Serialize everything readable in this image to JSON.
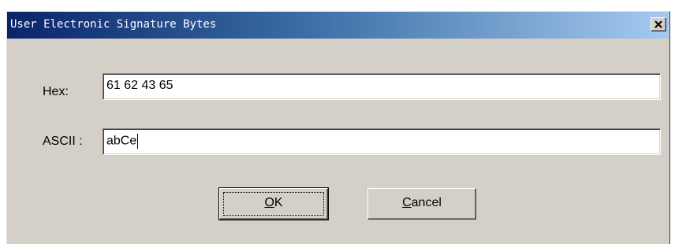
{
  "window": {
    "title": "User Electronic Signature Bytes",
    "close_icon": "close-icon"
  },
  "form": {
    "hex_label": "Hex:",
    "hex_value": "61 62 43 65",
    "ascii_label": "ASCII :",
    "ascii_value": "abCe"
  },
  "buttons": {
    "ok_label_mnemonic": "O",
    "ok_label_rest": "K",
    "cancel_label_mnemonic": "C",
    "cancel_label_rest": "ancel"
  },
  "colors": {
    "face": "#d4d0c8",
    "title_start": "#0a246a",
    "title_end": "#a6caf0"
  }
}
